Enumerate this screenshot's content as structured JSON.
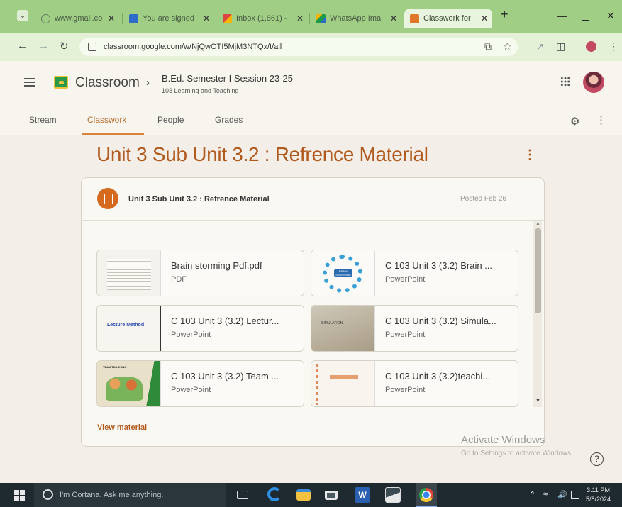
{
  "browser": {
    "tabs": [
      {
        "title": "www.gmail.co",
        "icon": "globe-icon"
      },
      {
        "title": "You are signed",
        "icon": "s-icon"
      },
      {
        "title": "Inbox (1,861) -",
        "icon": "gmail-icon"
      },
      {
        "title": "WhatsApp Ima",
        "icon": "drive-icon"
      },
      {
        "title": "Classwork for",
        "icon": "classroom-icon"
      }
    ],
    "new_tab": "+",
    "url": "classroom.google.com/w/NjQwOTI5MjM3NTQx/t/all"
  },
  "header": {
    "app_name": "Classroom",
    "course_title": "B.Ed. Semester I Session 23-25",
    "course_subtitle": "103 Learning and Teaching",
    "tabs": [
      "Stream",
      "Classwork",
      "People",
      "Grades"
    ],
    "active_tab": "Classwork"
  },
  "topic": {
    "title": "Unit 3 Sub Unit 3.2 : Refrence Material"
  },
  "material": {
    "title": "Unit 3 Sub Unit 3.2 : Refrence Material",
    "posted": "Posted Feb 26",
    "attachments": [
      {
        "name": "Brain storming Pdf.pdf",
        "type": "PDF",
        "thumb_text": ""
      },
      {
        "name": "C 103 Unit 3 (3.2) Brain ...",
        "type": "PowerPoint",
        "thumb_text": "BRAIN STORMING"
      },
      {
        "name": "C 103 Unit 3 (3.2) Lectur...",
        "type": "PowerPoint",
        "thumb_text": "Lecture Method"
      },
      {
        "name": "C 103 Unit 3 (3.2) Simula...",
        "type": "PowerPoint",
        "thumb_text": "SIMULATION"
      },
      {
        "name": "C 103 Unit 3 (3.2) Team ...",
        "type": "PowerPoint",
        "thumb_text": "TEAM TEACHING"
      },
      {
        "name": "C 103 Unit 3 (3.2)teachi...",
        "type": "PowerPoint",
        "thumb_text": ""
      }
    ],
    "view_link": "View material"
  },
  "watermark": {
    "line1": "Activate Windows",
    "line2": "Go to Settings to activate Windows."
  },
  "taskbar": {
    "search_placeholder": "I'm Cortana. Ask me anything.",
    "time": "3:11 PM",
    "date": "5/8/2024"
  },
  "colors": {
    "accent": "#b15a1e",
    "tab_underline": "#d9843a",
    "browser_frame": "#9fce84"
  }
}
